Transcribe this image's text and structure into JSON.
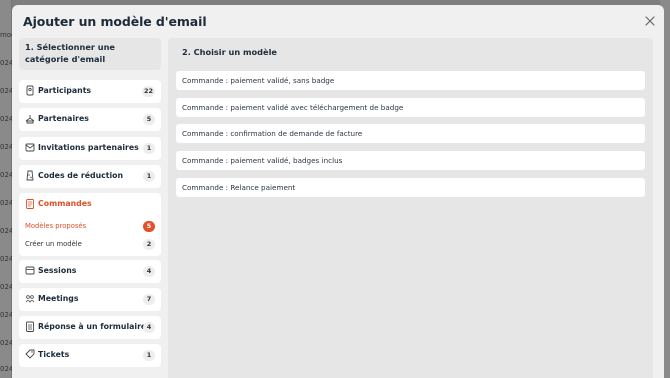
{
  "background": {
    "column_cells": [
      "mod",
      "024",
      "024",
      "024",
      "024",
      "024",
      "024",
      "024",
      "024",
      "024",
      "024",
      "024",
      "024",
      "024"
    ]
  },
  "modal": {
    "title": "Ajouter un modèle d'email",
    "close_icon": "close-icon"
  },
  "left": {
    "heading": "1. Sélectionner une catégorie d'email",
    "categories": [
      {
        "label": "Participants",
        "count": "22",
        "icon": "ticket-icon"
      },
      {
        "label": "Partenaires",
        "count": "5",
        "icon": "handshake-icon"
      },
      {
        "label": "Invitations partenaires",
        "count": "1",
        "icon": "invitation-icon"
      },
      {
        "label": "Codes de réduction",
        "count": "1",
        "icon": "discount-icon"
      }
    ],
    "open_category": {
      "label": "Commandes",
      "icon": "clipboard-icon",
      "subitems": [
        {
          "label": "Modèles proposés",
          "count": "5",
          "active": true
        },
        {
          "label": "Créer un modèle",
          "count": "2",
          "active": false
        }
      ]
    },
    "categories_after": [
      {
        "label": "Sessions",
        "count": "4",
        "icon": "sessions-icon"
      },
      {
        "label": "Meetings",
        "count": "7",
        "icon": "meetings-icon"
      },
      {
        "label": "Réponse à un formulaire",
        "count": "4",
        "icon": "form-icon"
      },
      {
        "label": "Tickets",
        "count": "1",
        "icon": "tag-icon"
      }
    ]
  },
  "right": {
    "heading": "2. Choisir un modèle",
    "templates": [
      "Commande : paiement validé, sans badge",
      "Commande : paiement validé avec téléchargement de badge",
      "Commande : confirmation de demande de facture",
      "Commande : paiement validé, badges inclus",
      "Commande : Relance paiement"
    ]
  },
  "colors": {
    "accent": "#e0502b",
    "text": "#1d2b3a",
    "panel": "#e6e6e6",
    "modal_bg": "#f0f0f0"
  }
}
